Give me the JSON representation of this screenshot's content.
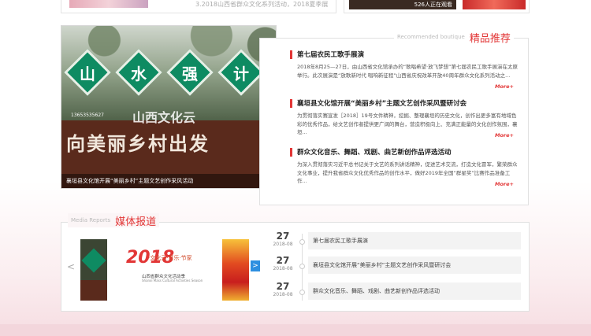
{
  "top_strip": {
    "left_text": "3.2018山西省群众文化系列活动，2018夏季展",
    "watch_count": "526人正在观看"
  },
  "slider": {
    "sign_chars": [
      "山",
      "水",
      "强",
      "计"
    ],
    "sign_text": "向美丽乡村出发",
    "sign_logo": "山西文化云",
    "sign_phone": "13653535627",
    "caption": "襄垣县文化馆开展“美丽乡村”主题文艺创作采风活动"
  },
  "recommended": {
    "title_en": "Recommended boutique",
    "title_cn": "精品推荐",
    "items": [
      {
        "title": "第七届农民工歌手展演",
        "desc": "2018年8月25—27日，由山西省文化馆承办的“歌唱希望·放飞梦想”第七届农民工歌手展演在太原举行。此次展演是“放歌新时代 唱响新征程”山西省庆祝改革开放40周年群众文化系列活动之...",
        "more": "More+"
      },
      {
        "title": "襄垣县文化馆开展“美丽乡村”主题文艺创作采风暨研讨会",
        "desc": "为贯彻落实赛宣发［2018］19号文件精神，挖掘、整理襄垣的历史文化，创作出更多富有地域色彩的优秀作品，给文艺创作者提供更广阔的舞台，营造积极向上、充满正能量的文化创作氛围，襄垣...",
        "more": "More+"
      },
      {
        "title": "群众文化音乐、舞蹈、戏剧、曲艺新创作品评选活动",
        "desc": "为深入贯彻落实习近平总书记关于文艺的系列讲话精神，促进艺术交流，打造文化冒军，繁荣群众文化事业，提升我省群众文化优秀作品的创作水平，做好2019年全国“群星奖”比赛作品准备工作...",
        "more": "More+"
      }
    ]
  },
  "media": {
    "title_en": "Media Reports",
    "title_cn": "媒体报道",
    "prev_arrow": "<",
    "next_arrow": ">",
    "logo_mark": "2018",
    "logo_line1": "·文化云·音乐·节家",
    "logo_line2": "山西省群众文化活动季",
    "logo_line3": "Shanxi Mass Cultural Activities Season",
    "timeline": [
      {
        "day": "27",
        "ym": "2018-08",
        "text": "第七届农民工歌手展演"
      },
      {
        "day": "27",
        "ym": "2018-08",
        "text": "襄垣县文化馆开展“美丽乡村”主题文艺创作采风暨研讨会"
      },
      {
        "day": "27",
        "ym": "2018-08",
        "text": "群众文化音乐、舞蹈、戏剧、曲艺新创作品评选活动"
      }
    ]
  },
  "colors": {
    "accent": "#e23636",
    "link_blue": "#2d8fe0"
  }
}
